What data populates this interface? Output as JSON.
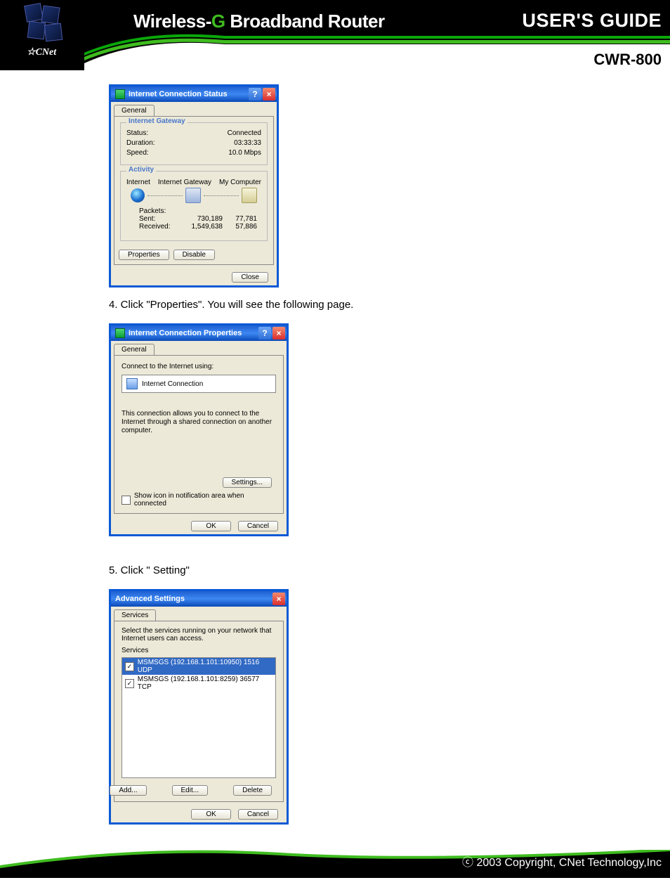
{
  "header": {
    "title_a": "Wireless-",
    "title_g": "G",
    "title_b": " Broadband Router",
    "guide": "USER'S GUIDE",
    "brand": "CNet",
    "model": "CWR-800"
  },
  "steps": {
    "s4": "4. Click \"Properties\". You will see the following page.",
    "s5": "5. Click \" Setting\""
  },
  "dlg1": {
    "title": "Internet Connection Status",
    "tab": "General",
    "group_gateway": "Internet Gateway",
    "status_l": "Status:",
    "status_v": "Connected",
    "dur_l": "Duration:",
    "dur_v": "03:33:33",
    "spd_l": "Speed:",
    "spd_v": "10.0 Mbps",
    "group_activity": "Activity",
    "act_a": "Internet",
    "act_b": "Internet Gateway",
    "act_c": "My Computer",
    "pkt_label": "Packets:",
    "pkt_sent": "Sent:",
    "pkt_recv": "Received:",
    "col_gw_sent": "730,189",
    "col_gw_recv": "1,549,638",
    "col_pc_sent": "77,781",
    "col_pc_recv": "57,886",
    "btn_props": "Properties",
    "btn_disable": "Disable",
    "btn_close": "Close"
  },
  "dlg2": {
    "title": "Internet Connection Properties",
    "tab": "General",
    "connect_label": "Connect to the Internet using:",
    "connect_value": "Internet Connection",
    "desc": "This connection allows you to connect to the Internet through a shared connection on another computer.",
    "btn_settings": "Settings...",
    "chk_label": "Show icon in notification area when connected",
    "btn_ok": "OK",
    "btn_cancel": "Cancel"
  },
  "dlg3": {
    "title": "Advanced Settings",
    "tab": "Services",
    "instr": "Select the services running on your network that Internet users can access.",
    "svc_label": "Services",
    "items": [
      "MSMSGS (192.168.1.101:10950) 1516 UDP",
      "MSMSGS (192.168.1.101:8259) 36577 TCP"
    ],
    "btn_add": "Add...",
    "btn_edit": "Edit...",
    "btn_del": "Delete",
    "btn_ok": "OK",
    "btn_cancel": "Cancel"
  },
  "footer": {
    "copy": "2003 Copyright, CNet Technology,Inc"
  }
}
